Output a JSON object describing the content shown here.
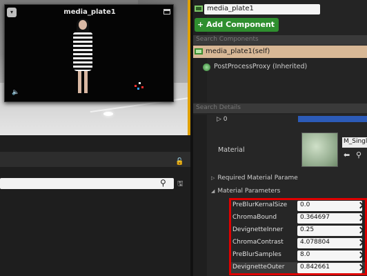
{
  "viewport": {
    "preview_title": "media_plate1",
    "dropdown_glyph": "▾",
    "mute_glyph": "🔈"
  },
  "left_panel": {
    "lock_glyph": "🔓",
    "search_glyph": "⚲",
    "save_glyph": "🖫"
  },
  "details": {
    "actor_name": "media_plate1",
    "add_component_label": "+ Add Component ▾",
    "search_components_placeholder": "Search Components",
    "components": [
      {
        "label": "media_plate1(self)"
      },
      {
        "label": "PostProcessProxy (Inherited)"
      }
    ],
    "search_details_placeholder": "Search Details",
    "row_zero": "▷ 0",
    "material_label": "Material",
    "material_name": "M_Singl",
    "material_arrow": "⬅",
    "material_find": "⚲",
    "required_params": "Required Material Parame",
    "material_params": "Material Parameters",
    "params": [
      {
        "name": "PreBlurKernalSize",
        "value": "0.0"
      },
      {
        "name": "ChromaBound",
        "value": "0.364697"
      },
      {
        "name": "DevignetteInner",
        "value": "0.25"
      },
      {
        "name": "ChromaContrast",
        "value": "4.078804"
      },
      {
        "name": "PreBlurSamples",
        "value": "8.0"
      },
      {
        "name": "DevignetteOuter",
        "value": "0.842661"
      }
    ]
  },
  "colors": {
    "highlight_border": "#e00000",
    "add_button": "#2f8f2f",
    "selected_component": "#d8b896",
    "viewport_edge": "#e0a000"
  }
}
